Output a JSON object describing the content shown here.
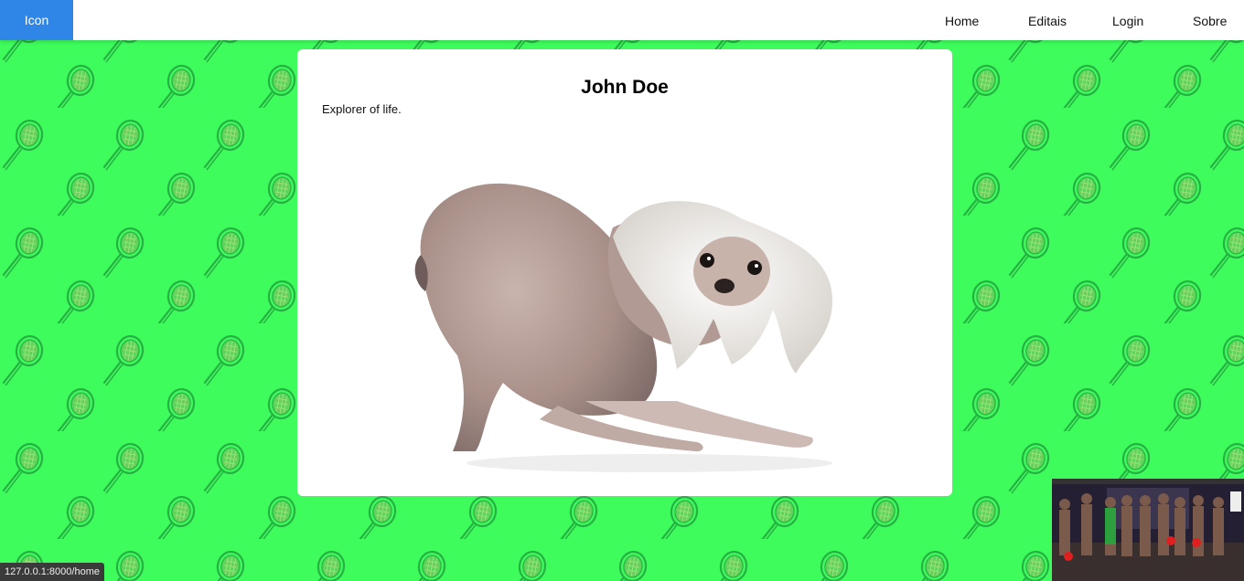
{
  "navbar": {
    "brand_label": "Icon",
    "links": [
      {
        "label": "Home"
      },
      {
        "label": "Editais"
      },
      {
        "label": "Login"
      },
      {
        "label": "Sobre"
      }
    ]
  },
  "profile": {
    "name": "John Doe",
    "bio": "Explorer of life.",
    "image_icon": "hairless-dog-photo"
  },
  "status_bar": {
    "url": "127.0.0.1:8000/home"
  },
  "overlay": {
    "icon": "video-thumbnail"
  },
  "colors": {
    "background": "#3dfc5c",
    "pattern": "#2ebf4a",
    "brand": "#2f86e6"
  }
}
